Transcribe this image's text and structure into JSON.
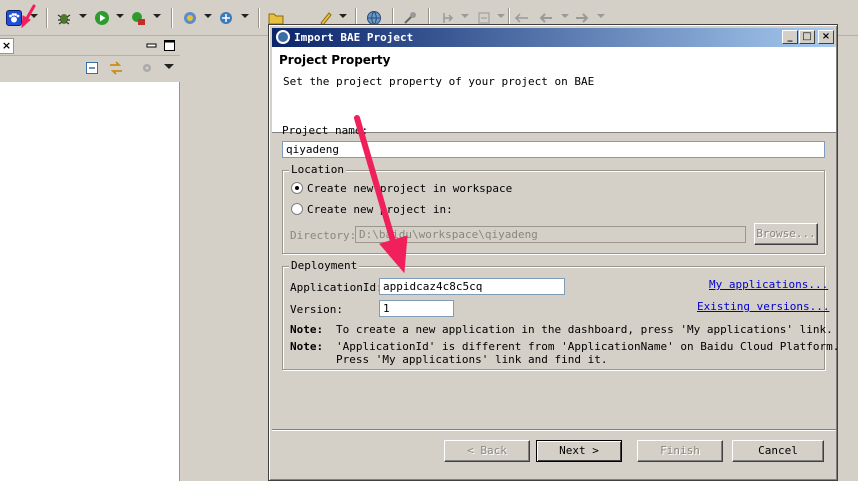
{
  "colors": {
    "title_bar": "#0a246a",
    "arrow": "#f0205a",
    "link": "#0000cc",
    "window_bg": "#d4d0c8"
  },
  "toolbar": {
    "icons": [
      "baidu-paw-icon",
      "debug-icon",
      "run-icon",
      "external-tools-icon",
      "new-wizard-icon",
      "new-server-icon",
      "open-type-icon",
      "search-icon",
      "globe-icon",
      "annotation-icon",
      "next-annotation-icon",
      "prev-annotation-icon",
      "back-icon",
      "forward-icon"
    ]
  },
  "left_view": {
    "close_glyph": "×",
    "minimize_glyph": "—",
    "maximize_glyph": "☐"
  },
  "dialog": {
    "title": "Import BAE Project",
    "caption_buttons": {
      "minimize": "_",
      "maximize": "□",
      "close": "×"
    },
    "header": {
      "title": "Project Property",
      "description": "Set the project property of your project on BAE"
    },
    "project_name": {
      "label": "Project name:",
      "value": "qiyadeng"
    },
    "location": {
      "legend": "Location",
      "option_workspace": "Create new project in workspace",
      "option_custom": "Create new project in:",
      "directory_label": "Directory:",
      "directory_value": "D:\\baidu\\workspace\\qiyadeng",
      "browse_label": "Browse..."
    },
    "deployment": {
      "legend": "Deployment",
      "app_id_label": "ApplicationId:",
      "app_id_value": "appidcaz4c8c5cq",
      "version_label": "Version:",
      "version_value": "1",
      "my_apps_link": "My applications...",
      "existing_versions_link": "Existing versions...",
      "note1_label": "Note:",
      "note1_text": "To create a new application in the dashboard, press 'My applications' link.",
      "note2_label": "Note:",
      "note2_line1": "'ApplicationId' is different from 'ApplicationName' on Baidu Cloud Platform.",
      "note2_line2": "Press 'My applications' link and find it."
    },
    "buttons": {
      "back": "< Back",
      "next": "Next >",
      "finish": "Finish",
      "cancel": "Cancel"
    }
  }
}
